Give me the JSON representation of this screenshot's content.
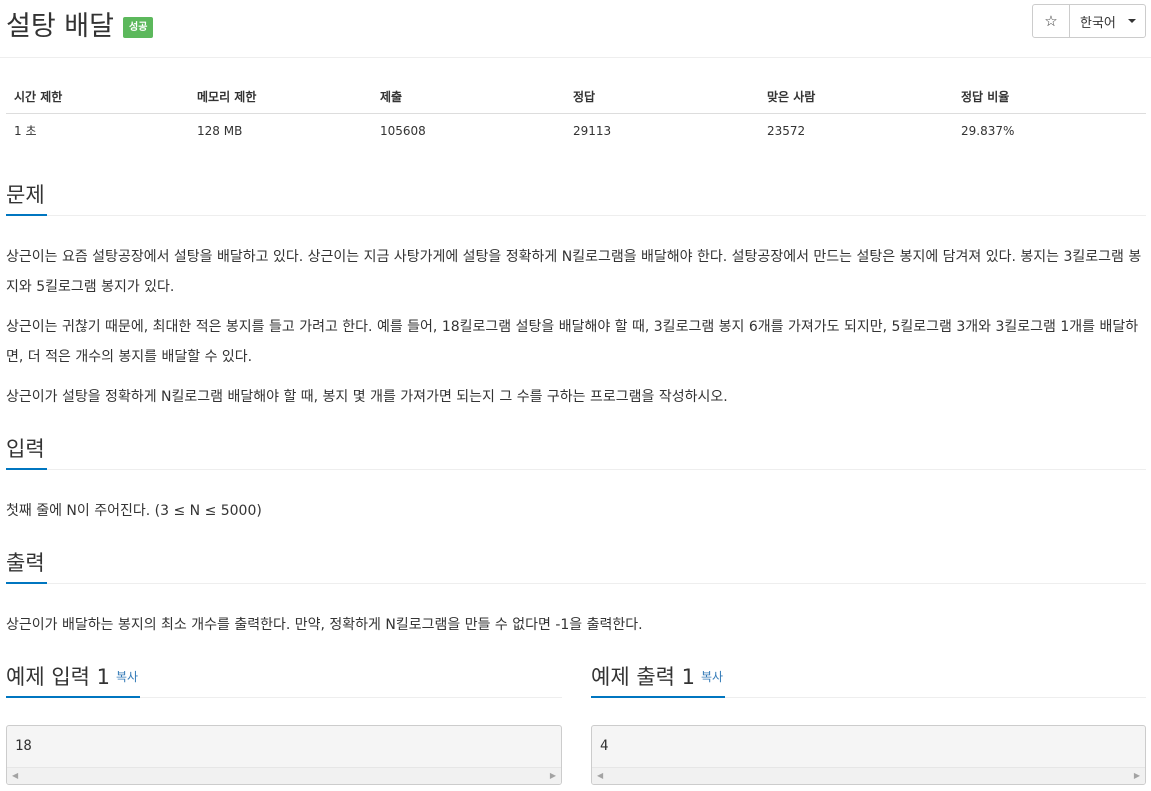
{
  "header": {
    "title": "설탕 배달",
    "badge": "성공",
    "star_icon": "☆",
    "language": "한국어"
  },
  "info_table": {
    "headers": [
      "시간 제한",
      "메모리 제한",
      "제출",
      "정답",
      "맞은 사람",
      "정답 비율"
    ],
    "values": [
      "1 초",
      "128 MB",
      "105608",
      "29113",
      "23572",
      "29.837%"
    ]
  },
  "problem": {
    "heading": "문제",
    "paragraphs": [
      "상근이는 요즘 설탕공장에서 설탕을 배달하고 있다. 상근이는 지금 사탕가게에 설탕을 정확하게 N킬로그램을 배달해야 한다. 설탕공장에서 만드는 설탕은 봉지에 담겨져 있다. 봉지는 3킬로그램 봉지와 5킬로그램 봉지가 있다.",
      "상근이는 귀찮기 때문에, 최대한 적은 봉지를 들고 가려고 한다. 예를 들어, 18킬로그램 설탕을 배달해야 할 때, 3킬로그램 봉지 6개를 가져가도 되지만, 5킬로그램 3개와 3킬로그램 1개를 배달하면, 더 적은 개수의 봉지를 배달할 수 있다.",
      "상근이가 설탕을 정확하게 N킬로그램 배달해야 할 때, 봉지 몇 개를 가져가면 되는지 그 수를 구하는 프로그램을 작성하시오."
    ]
  },
  "input": {
    "heading": "입력",
    "text": "첫째 줄에 N이 주어진다. (3 ≤ N ≤ 5000)"
  },
  "output": {
    "heading": "출력",
    "text": "상근이가 배달하는 봉지의 최소 개수를 출력한다. 만약, 정확하게 N킬로그램을 만들 수 없다면 -1을 출력한다."
  },
  "samples": {
    "input_heading": "예제 입력 1",
    "output_heading": "예제 출력 1",
    "copy_label": "복사",
    "input_value": "18",
    "output_value": "4"
  },
  "colors": {
    "badge": "#5cb85c",
    "heading_underline": "#0076c0",
    "link": "#337ab7"
  }
}
